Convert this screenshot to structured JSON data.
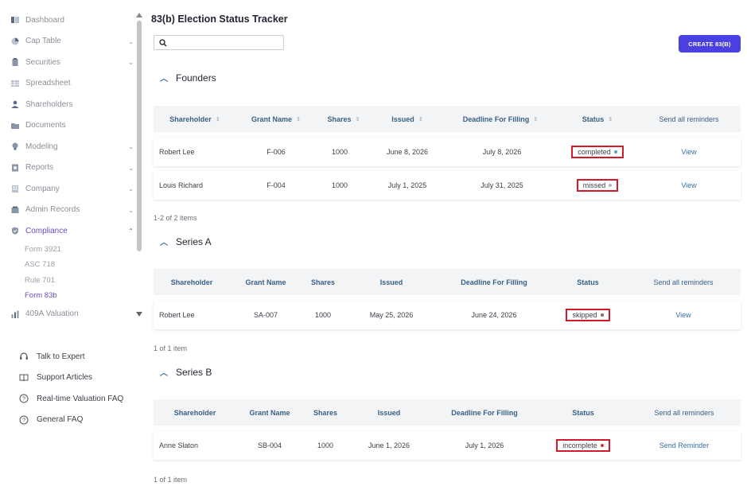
{
  "sidebar": {
    "items": [
      {
        "label": "Dashboard",
        "icon": "dashboard-icon",
        "chevron": ""
      },
      {
        "label": "Cap Table",
        "icon": "pie-chart-icon",
        "chevron": "⌄"
      },
      {
        "label": "Securities",
        "icon": "clipboard-icon",
        "chevron": "⌄"
      },
      {
        "label": "Spreadsheet",
        "icon": "spreadsheet-icon",
        "chevron": ""
      },
      {
        "label": "Shareholders",
        "icon": "person-icon",
        "chevron": ""
      },
      {
        "label": "Documents",
        "icon": "folder-icon",
        "chevron": ""
      },
      {
        "label": "Modeling",
        "icon": "bulb-icon",
        "chevron": "⌄"
      },
      {
        "label": "Reports",
        "icon": "report-icon",
        "chevron": "⌄"
      },
      {
        "label": "Company",
        "icon": "building-icon",
        "chevron": "⌄"
      },
      {
        "label": "Admin Records",
        "icon": "admin-icon",
        "chevron": "⌄"
      },
      {
        "label": "Compliance",
        "icon": "shield-check-icon",
        "chevron": "⌃"
      }
    ],
    "subitems": [
      "Form 3921",
      "ASC 718",
      "Rule 701",
      "Form 83b"
    ],
    "after": {
      "label": "409A Valuation",
      "icon": "bar-chart-icon"
    },
    "help": [
      {
        "label": "Talk to Expert",
        "icon": "headset-icon"
      },
      {
        "label": "Support Articles",
        "icon": "book-icon"
      },
      {
        "label": "Real-time Valuation FAQ",
        "icon": "question-icon"
      },
      {
        "label": "General FAQ",
        "icon": "question-icon"
      }
    ]
  },
  "page": {
    "title": "83(b) Election Status Tracker",
    "search_placeholder": "",
    "create_label": "CREATE 83(B)"
  },
  "sections": [
    {
      "name": "Founders",
      "headers": [
        "Shareholder",
        "Grant Name",
        "Shares",
        "Issued",
        "Deadline For Filling",
        "Status",
        "Send all reminders"
      ],
      "sortable": true,
      "rows": [
        {
          "shareholder": "Robert Lee",
          "grant": "F-006",
          "shares": "1000",
          "issued": "June 8, 2026",
          "deadline": "July 8, 2026",
          "status": "completed",
          "dot": "#5a9bd5",
          "action": "View"
        },
        {
          "shareholder": "Louis Richard",
          "grant": "F-004",
          "shares": "1000",
          "issued": "July 1, 2025",
          "deadline": "July 31, 2025",
          "status": "missed",
          "dot": "#b0b6bd",
          "action": "View"
        }
      ],
      "count": "1-2 of 2 items"
    },
    {
      "name": "Series A",
      "headers": [
        "Shareholder",
        "Grant Name",
        "Shares",
        "Issued",
        "Deadline For Filling",
        "Status",
        "Send all reminders"
      ],
      "sortable": false,
      "rows": [
        {
          "shareholder": "Robert Lee",
          "grant": "SA-007",
          "shares": "1000",
          "issued": "May 25, 2026",
          "deadline": "June 24, 2026",
          "status": "skipped",
          "dot": "#8a6a5a",
          "action": "View"
        }
      ],
      "count": "1 of 1 item"
    },
    {
      "name": "Series B",
      "headers": [
        "Shareholder",
        "Grant Name",
        "Shares",
        "Issued",
        "Deadline For Filling",
        "Status",
        "Send all reminders"
      ],
      "sortable": false,
      "rows": [
        {
          "shareholder": "Anne Slaton",
          "grant": "SB-004",
          "shares": "1000",
          "issued": "June 1, 2026",
          "deadline": "July 1, 2026",
          "status": "incomplete",
          "dot": "#c0392b",
          "action": "Send Reminder"
        }
      ],
      "count": "1 of 1 item"
    }
  ],
  "colors": {
    "accent": "#6a4bbd",
    "button": "#4a3fe0",
    "highlight_border": "#d11a2a",
    "header_text": "#3a5f84"
  }
}
